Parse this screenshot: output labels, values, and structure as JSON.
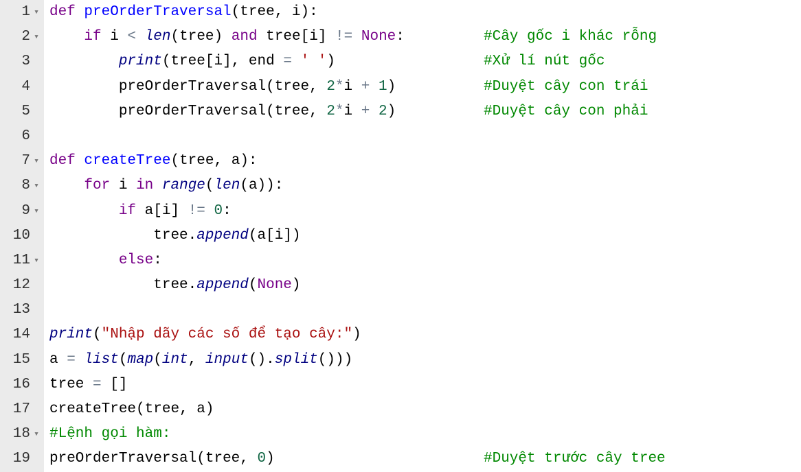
{
  "lines": [
    {
      "num": "1",
      "fold": true
    },
    {
      "num": "2",
      "fold": true
    },
    {
      "num": "3",
      "fold": false
    },
    {
      "num": "4",
      "fold": false
    },
    {
      "num": "5",
      "fold": false
    },
    {
      "num": "6",
      "fold": false
    },
    {
      "num": "7",
      "fold": true
    },
    {
      "num": "8",
      "fold": true
    },
    {
      "num": "9",
      "fold": true
    },
    {
      "num": "10",
      "fold": false
    },
    {
      "num": "11",
      "fold": true
    },
    {
      "num": "12",
      "fold": false
    },
    {
      "num": "13",
      "fold": false
    },
    {
      "num": "14",
      "fold": false
    },
    {
      "num": "15",
      "fold": false
    },
    {
      "num": "16",
      "fold": false
    },
    {
      "num": "17",
      "fold": false
    },
    {
      "num": "18",
      "fold": true
    },
    {
      "num": "19",
      "fold": false
    }
  ],
  "tokens": {
    "def": "def",
    "preOrderTraversal": "preOrderTraversal",
    "createTree": "createTree",
    "tree": "tree",
    "i": "i",
    "a": "a",
    "if": "if",
    "for": "for",
    "in": "in",
    "else": "else",
    "len": "len",
    "and": "and",
    "None": "None",
    "print": "print",
    "end": "end",
    "range": "range",
    "append": "append",
    "list": "list",
    "map": "map",
    "int": "int",
    "input": "input",
    "split": "split",
    "lparen": "(",
    "rparen": ")",
    "comma": ",",
    "colon": ":",
    "lbracket": "[",
    "rbracket": "]",
    "lt": "<",
    "neq": "!=",
    "eq": "=",
    "star": "*",
    "plus": "+",
    "dot": ".",
    "space_str": "' '",
    "prompt_str": "\"Nhập dãy các số để tạo cây:\"",
    "n0": "0",
    "n1": "1",
    "n2": "2",
    "empty_list": "[]"
  },
  "comments": {
    "c1": "#Cây gốc i khác rỗng",
    "c2": "#Xử lí nút gốc",
    "c3": "#Duyệt cây con trái",
    "c4": "#Duyệt cây con phải",
    "c5": "#Lệnh gọi hàm:",
    "c6": "#Duyệt trước cây tree"
  }
}
